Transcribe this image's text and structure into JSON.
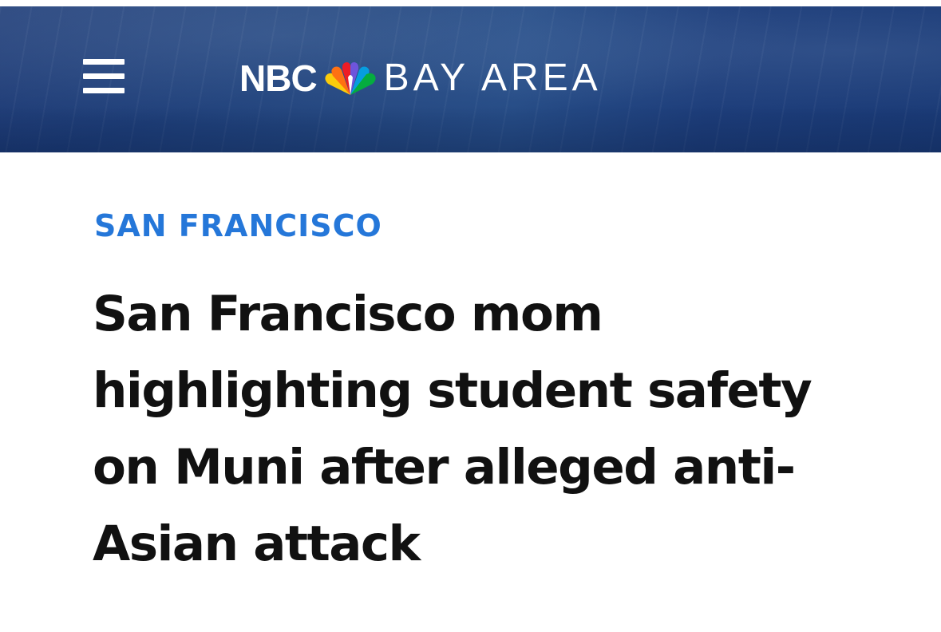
{
  "header": {
    "menu_icon": "hamburger-menu-icon",
    "logo": {
      "network": "NBC",
      "peacock_icon": "nbc-peacock-icon",
      "region": "BAY AREA"
    },
    "background_color": "#1f427f"
  },
  "article": {
    "section": "SAN FRANCISCO",
    "section_color": "#2577d9",
    "headline_lines": [
      "San Francisco mom",
      "highlighting student safety",
      "on Muni after alleged anti-",
      "Asian attack"
    ]
  }
}
